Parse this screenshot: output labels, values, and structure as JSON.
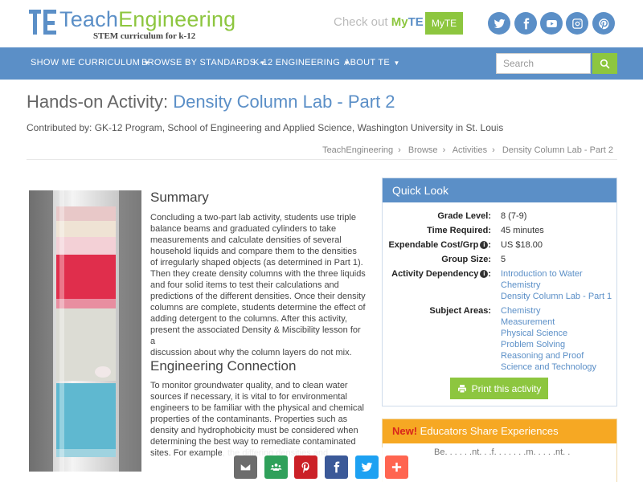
{
  "logo": {
    "part1": "Teach",
    "part2": "Engineering",
    "tagline": "STEM curriculum for k-12"
  },
  "header": {
    "checkout": "Check out",
    "myte_my": "My",
    "myte_te": "TE",
    "myte_button": "MyTE"
  },
  "social": [
    "twitter-icon",
    "facebook-icon",
    "youtube-icon",
    "instagram-icon",
    "pinterest-icon"
  ],
  "nav": {
    "items": [
      {
        "label": "SHOW ME CURRICULUM"
      },
      {
        "label": "BROWSE BY STANDARDS"
      },
      {
        "label": "K-12 ENGINEERING"
      },
      {
        "label": "ABOUT TE"
      }
    ],
    "search_placeholder": "Search"
  },
  "page": {
    "title_prefix": "Hands-on Activity:",
    "title": "Density Column Lab - Part 2",
    "contributed": "Contributed by: GK-12 Program, School of Engineering and Applied Science, Washington University in St. Louis",
    "breadcrumb": [
      "TeachEngineering",
      "Browse",
      "Activities",
      "Density Column Lab - Part 2"
    ]
  },
  "summary": {
    "heading": "Summary",
    "lines": [
      "Concluding a two-part lab activity, students use triple",
      "balance beams and graduated cylinders to take",
      "measurements and calculate densities of several",
      "household liquids and compare them to the densities",
      "of irregularly shaped objects (as determined in Part 1).",
      "Then they create density columns with the three liquids",
      "and four solid items to test their calculations and",
      "predictions of the different densities. Once their density",
      "columns are complete, students determine the effect of",
      "adding detergent to the columns. After this activity,",
      "present the associated Density & Miscibility lesson for a",
      "discussion about why the column layers do not mix."
    ]
  },
  "engineering": {
    "heading": "Engineering Connection",
    "lines": [
      "To monitor groundwater quality, and to clean water",
      "sources if necessary, it is vital to for environmental",
      "engineers to be familiar with the physical and chemical",
      "properties of the contaminants. Properties such as",
      "density and hydrophobicity must be considered when",
      "determining the best way to remediate contaminated",
      "sites. For example, the differing densities and"
    ]
  },
  "quick_look": {
    "heading": "Quick Look",
    "grade_label": "Grade Level:",
    "grade": "8 (7-9)",
    "time_label": "Time Required:",
    "time": "45 minutes",
    "cost_label": "Expendable Cost/Grp",
    "cost": "US $18.00",
    "group_label": "Group Size:",
    "group": "5",
    "dependency_label": "Activity Dependency",
    "dependency": [
      "Introduction to Water",
      "Chemistry",
      "Density Column Lab - Part 1"
    ],
    "subject_label": "Subject Areas:",
    "subjects": [
      "Chemistry",
      "Measurement",
      "Physical Science",
      "Problem Solving",
      "Reasoning and Proof",
      "Science and Technology"
    ],
    "print": "Print this activity"
  },
  "educators": {
    "new": "New!",
    "heading": " Educators Share Experiences",
    "text": "Be. . . . . .nt. . .f. . . . . . .m. . . . .nt. ."
  },
  "colors": {
    "brand_blue": "#5b8fc7",
    "brand_green": "#8dc63f",
    "orange": "#f6a823"
  }
}
